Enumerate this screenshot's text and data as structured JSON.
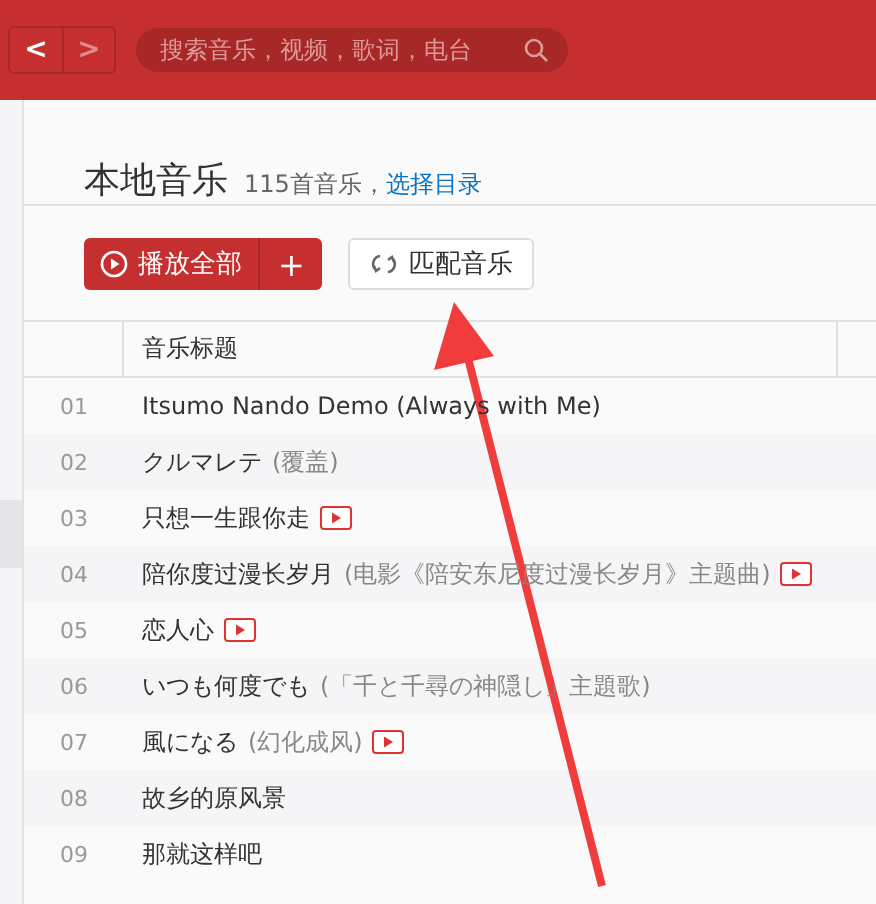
{
  "nav": {
    "back": {
      "label": "<",
      "disabled": false
    },
    "forward": {
      "label": ">",
      "disabled": true
    }
  },
  "search": {
    "placeholder": "搜索音乐，视频，歌词，电台"
  },
  "header": {
    "title": "本地音乐",
    "count": "115首音乐，",
    "link": "选择目录"
  },
  "actions": {
    "play_all": "播放全部",
    "add": "+",
    "match": "匹配音乐"
  },
  "table": {
    "columns": [
      "音乐标题"
    ],
    "rows": [
      {
        "number": "01",
        "title": "Itsumo Nando Demo (Always with Me)",
        "subtitle": "",
        "mv": false
      },
      {
        "number": "02",
        "title": "クルマレテ",
        "subtitle": "(覆盖)",
        "mv": false
      },
      {
        "number": "03",
        "title": "只想一生跟你走",
        "subtitle": "",
        "mv": true
      },
      {
        "number": "04",
        "title": "陪你度过漫长岁月",
        "subtitle": "(电影《陪安东尼度过漫长岁月》主题曲)",
        "mv": true
      },
      {
        "number": "05",
        "title": "恋人心",
        "subtitle": "",
        "mv": true
      },
      {
        "number": "06",
        "title": "いつも何度でも",
        "subtitle": "(「千と千尋の神隠し」主題歌)",
        "mv": false
      },
      {
        "number": "07",
        "title": "風になる",
        "subtitle": "(幻化成风)",
        "mv": true
      },
      {
        "number": "08",
        "title": "故乡的原风景",
        "subtitle": "",
        "mv": false
      },
      {
        "number": "09",
        "title": "那就这样吧",
        "subtitle": "",
        "mv": false
      }
    ]
  }
}
